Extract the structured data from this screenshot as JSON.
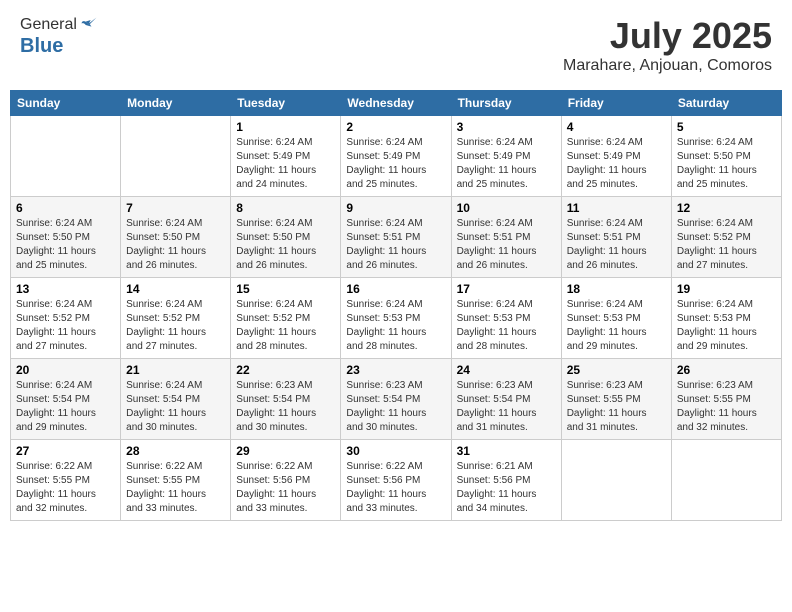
{
  "header": {
    "logo_general": "General",
    "logo_blue": "Blue",
    "month_title": "July 2025",
    "location": "Marahare, Anjouan, Comoros"
  },
  "weekdays": [
    "Sunday",
    "Monday",
    "Tuesday",
    "Wednesday",
    "Thursday",
    "Friday",
    "Saturday"
  ],
  "weeks": [
    [
      {
        "day": "",
        "info": ""
      },
      {
        "day": "",
        "info": ""
      },
      {
        "day": "1",
        "info": "Sunrise: 6:24 AM\nSunset: 5:49 PM\nDaylight: 11 hours and 24 minutes."
      },
      {
        "day": "2",
        "info": "Sunrise: 6:24 AM\nSunset: 5:49 PM\nDaylight: 11 hours and 25 minutes."
      },
      {
        "day": "3",
        "info": "Sunrise: 6:24 AM\nSunset: 5:49 PM\nDaylight: 11 hours and 25 minutes."
      },
      {
        "day": "4",
        "info": "Sunrise: 6:24 AM\nSunset: 5:49 PM\nDaylight: 11 hours and 25 minutes."
      },
      {
        "day": "5",
        "info": "Sunrise: 6:24 AM\nSunset: 5:50 PM\nDaylight: 11 hours and 25 minutes."
      }
    ],
    [
      {
        "day": "6",
        "info": "Sunrise: 6:24 AM\nSunset: 5:50 PM\nDaylight: 11 hours and 25 minutes."
      },
      {
        "day": "7",
        "info": "Sunrise: 6:24 AM\nSunset: 5:50 PM\nDaylight: 11 hours and 26 minutes."
      },
      {
        "day": "8",
        "info": "Sunrise: 6:24 AM\nSunset: 5:50 PM\nDaylight: 11 hours and 26 minutes."
      },
      {
        "day": "9",
        "info": "Sunrise: 6:24 AM\nSunset: 5:51 PM\nDaylight: 11 hours and 26 minutes."
      },
      {
        "day": "10",
        "info": "Sunrise: 6:24 AM\nSunset: 5:51 PM\nDaylight: 11 hours and 26 minutes."
      },
      {
        "day": "11",
        "info": "Sunrise: 6:24 AM\nSunset: 5:51 PM\nDaylight: 11 hours and 26 minutes."
      },
      {
        "day": "12",
        "info": "Sunrise: 6:24 AM\nSunset: 5:52 PM\nDaylight: 11 hours and 27 minutes."
      }
    ],
    [
      {
        "day": "13",
        "info": "Sunrise: 6:24 AM\nSunset: 5:52 PM\nDaylight: 11 hours and 27 minutes."
      },
      {
        "day": "14",
        "info": "Sunrise: 6:24 AM\nSunset: 5:52 PM\nDaylight: 11 hours and 27 minutes."
      },
      {
        "day": "15",
        "info": "Sunrise: 6:24 AM\nSunset: 5:52 PM\nDaylight: 11 hours and 28 minutes."
      },
      {
        "day": "16",
        "info": "Sunrise: 6:24 AM\nSunset: 5:53 PM\nDaylight: 11 hours and 28 minutes."
      },
      {
        "day": "17",
        "info": "Sunrise: 6:24 AM\nSunset: 5:53 PM\nDaylight: 11 hours and 28 minutes."
      },
      {
        "day": "18",
        "info": "Sunrise: 6:24 AM\nSunset: 5:53 PM\nDaylight: 11 hours and 29 minutes."
      },
      {
        "day": "19",
        "info": "Sunrise: 6:24 AM\nSunset: 5:53 PM\nDaylight: 11 hours and 29 minutes."
      }
    ],
    [
      {
        "day": "20",
        "info": "Sunrise: 6:24 AM\nSunset: 5:54 PM\nDaylight: 11 hours and 29 minutes."
      },
      {
        "day": "21",
        "info": "Sunrise: 6:24 AM\nSunset: 5:54 PM\nDaylight: 11 hours and 30 minutes."
      },
      {
        "day": "22",
        "info": "Sunrise: 6:23 AM\nSunset: 5:54 PM\nDaylight: 11 hours and 30 minutes."
      },
      {
        "day": "23",
        "info": "Sunrise: 6:23 AM\nSunset: 5:54 PM\nDaylight: 11 hours and 30 minutes."
      },
      {
        "day": "24",
        "info": "Sunrise: 6:23 AM\nSunset: 5:54 PM\nDaylight: 11 hours and 31 minutes."
      },
      {
        "day": "25",
        "info": "Sunrise: 6:23 AM\nSunset: 5:55 PM\nDaylight: 11 hours and 31 minutes."
      },
      {
        "day": "26",
        "info": "Sunrise: 6:23 AM\nSunset: 5:55 PM\nDaylight: 11 hours and 32 minutes."
      }
    ],
    [
      {
        "day": "27",
        "info": "Sunrise: 6:22 AM\nSunset: 5:55 PM\nDaylight: 11 hours and 32 minutes."
      },
      {
        "day": "28",
        "info": "Sunrise: 6:22 AM\nSunset: 5:55 PM\nDaylight: 11 hours and 33 minutes."
      },
      {
        "day": "29",
        "info": "Sunrise: 6:22 AM\nSunset: 5:56 PM\nDaylight: 11 hours and 33 minutes."
      },
      {
        "day": "30",
        "info": "Sunrise: 6:22 AM\nSunset: 5:56 PM\nDaylight: 11 hours and 33 minutes."
      },
      {
        "day": "31",
        "info": "Sunrise: 6:21 AM\nSunset: 5:56 PM\nDaylight: 11 hours and 34 minutes."
      },
      {
        "day": "",
        "info": ""
      },
      {
        "day": "",
        "info": ""
      }
    ]
  ]
}
